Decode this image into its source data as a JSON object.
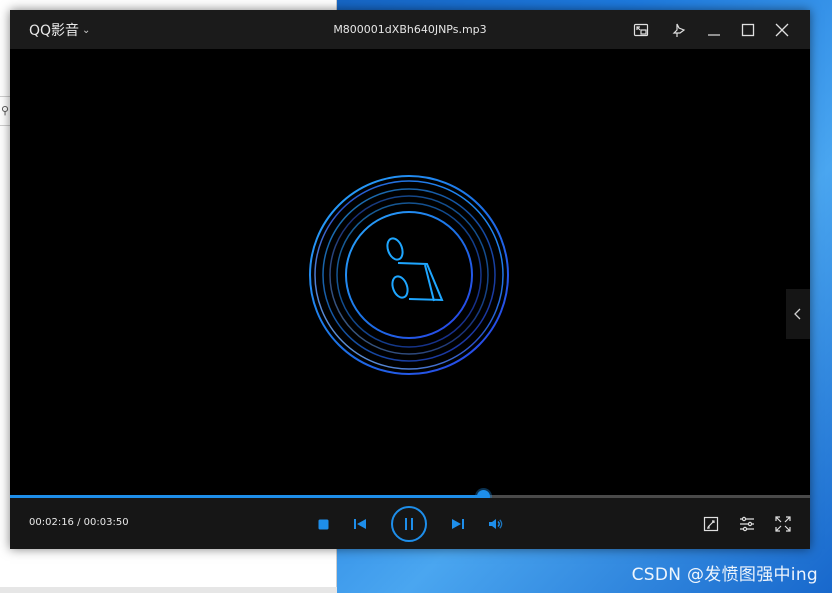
{
  "player": {
    "brand": "QQ影音",
    "file_title": "M800001dXBh640JNPs.mp3",
    "time_display": "00:02:16 / 00:03:50",
    "progress_fraction": 0.5913,
    "accent_color": "#1e8eea",
    "titlebar_buttons": [
      "mini-mode-icon",
      "pin-icon",
      "minimize-icon",
      "maximize-icon",
      "close-icon"
    ],
    "control_buttons": [
      "stop-icon",
      "previous-icon",
      "pause-icon",
      "next-icon",
      "volume-icon"
    ],
    "right_buttons": [
      "screenshot-tool-icon",
      "settings-sliders-icon",
      "fullscreen-icon"
    ]
  },
  "watermark": "CSDN @发愤图强中ing"
}
